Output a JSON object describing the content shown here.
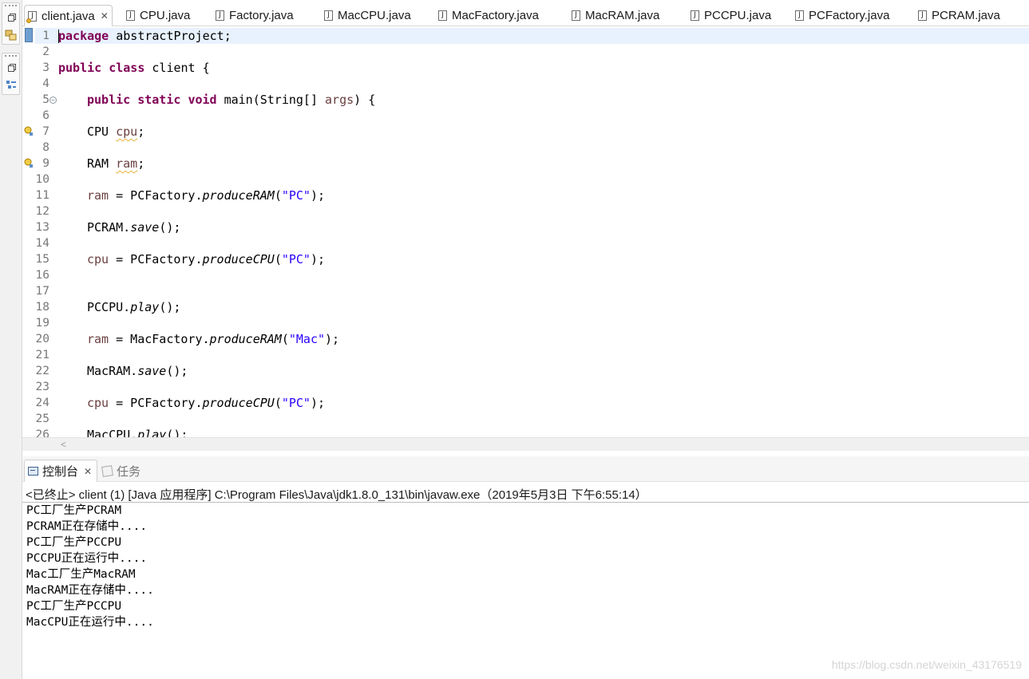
{
  "editor_tabs": [
    {
      "label": "client.java",
      "active": true,
      "closable": true
    },
    {
      "label": "CPU.java"
    },
    {
      "label": "Factory.java"
    },
    {
      "label": "MacCPU.java"
    },
    {
      "label": "MacFactory.java"
    },
    {
      "label": "MacRAM.java"
    },
    {
      "label": "PCCPU.java"
    },
    {
      "label": "PCFactory.java"
    },
    {
      "label": "PCRAM.java"
    }
  ],
  "code": {
    "line_numbers": [
      "1",
      "2",
      "3",
      "4",
      "5",
      "6",
      "7",
      "8",
      "9",
      "10",
      "11",
      "12",
      "13",
      "14",
      "15",
      "16",
      "17",
      "18",
      "19",
      "20",
      "21",
      "22",
      "23",
      "24",
      "25",
      "26"
    ],
    "warning_lines": [
      "7",
      "9"
    ],
    "lines": {
      "l1": {
        "kw": "package",
        "rest": " abstractProject;"
      },
      "l3": {
        "kw1": "public",
        "kw2": "class",
        "rest": " client {"
      },
      "l5": {
        "kw1": "public",
        "kw2": "static",
        "kw3": "void",
        "mid": " main(String[] ",
        "param": "args",
        "end": ") {"
      },
      "l7": {
        "type": "CPU ",
        "var": "cpu",
        "end": ";"
      },
      "l9": {
        "type": "RAM ",
        "var": "ram",
        "end": ";"
      },
      "l11": {
        "var": "ram",
        "mid": " = PCFactory.",
        "method": "produceRAM",
        "open": "(",
        "str": "\"PC\"",
        "end": ");"
      },
      "l13": {
        "cls": "PCRAM.",
        "method": "save",
        "end": "();"
      },
      "l15": {
        "var": "cpu",
        "mid": " = PCFactory.",
        "method": "produceCPU",
        "open": "(",
        "str": "\"PC\"",
        "end": ");"
      },
      "l18": {
        "cls": "PCCPU.",
        "method": "play",
        "end": "();"
      },
      "l20": {
        "var": "ram",
        "mid": " = MacFactory.",
        "method": "produceRAM",
        "open": "(",
        "str": "\"Mac\"",
        "end": ");"
      },
      "l22": {
        "cls": "MacRAM.",
        "method": "save",
        "end": "();"
      },
      "l24": {
        "var": "cpu",
        "mid": " = PCFactory.",
        "method": "produceCPU",
        "open": "(",
        "str": "\"PC\"",
        "end": ");"
      },
      "l26": {
        "cls": "MacCPU.",
        "method": "play",
        "end": "();"
      }
    }
  },
  "console": {
    "tabs": [
      {
        "label": "控制台",
        "active": true
      },
      {
        "label": "任务",
        "active": false
      }
    ],
    "header": "<已终止> client (1) [Java 应用程序] C:\\Program Files\\Java\\jdk1.8.0_131\\bin\\javaw.exe（2019年5月3日 下午6:55:14）",
    "output": [
      "PC工厂生产PCRAM",
      "PCRAM正在存储中....",
      "PC工厂生产PCCPU",
      "PCCPU正在运行中....",
      "Mac工厂生产MacRAM",
      "MacRAM正在存储中....",
      "PC工厂生产PCCPU",
      "MacCPU正在运行中...."
    ]
  },
  "watermark": "https://blog.csdn.net/weixin_43176519",
  "colors": {
    "keyword": "#7f0055",
    "string": "#2a00ff",
    "variable": "#6a3e3e",
    "line_number": "#787878",
    "current_line": "#e8f2fe"
  }
}
